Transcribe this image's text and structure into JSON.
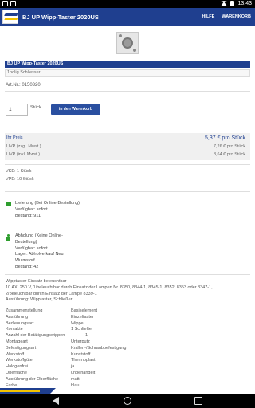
{
  "status_bar": {
    "time": "13:43"
  },
  "app_bar": {
    "title": "BJ UP Wipp-Taster 2020US",
    "menu_help": "HILFE",
    "menu_cart": "WARENKORB"
  },
  "product": {
    "title_bar": "BJ UP Wipp-Taster 2020US",
    "subtitle": "1polig Schliesser",
    "art_nr": "Art.Nr.: 0150320",
    "quantity_value": "1",
    "quantity_unit": "Stück",
    "add_to_cart": "in den Warenkorb"
  },
  "prices": {
    "main_label": "Ihr Preis",
    "main_value": "5,37 € pro  Stück",
    "uvp_excl_label": "UVP (zzgl. Mwst.)",
    "uvp_excl_value": "7,26 € pro  Stück",
    "uvp_incl_label": "UVP (inkl. Mwst.)",
    "uvp_incl_value": "8,64 € pro  Stück"
  },
  "units": {
    "vke": "VKE: 1 Stück",
    "vpe": "VPE: 10 Stück"
  },
  "delivery": {
    "lines": [
      "Lieferung (Bei Online-Bestellung)",
      "Verfügbar: sofort",
      "Bestand: 911"
    ]
  },
  "pickup": {
    "lines": [
      "Abholung (Keine Online-",
      "Bestellung)",
      "Verfügbar: sofort",
      "Lager: Abholverkauf Neu",
      "Wulmstorf",
      "Bestand: 42"
    ]
  },
  "description": {
    "lines": [
      "Wipptaster-Einsatz beleuchtbar",
      "10 AX, 250 V, 1/beleuchtbar durch Einsatz der Lampen Nr. 8350, 8344-1, 8345-1, 8352, 8353 oder 8347-1,",
      "2/beleuchtbar durch Einsatz der Lampe 8339-1",
      "Ausführung: Wipptaster, Schließer"
    ]
  },
  "specs": [
    {
      "key": "Zusammenstellung",
      "value": "Basiselement"
    },
    {
      "key": "Ausführung",
      "value": "Einzeltaster"
    },
    {
      "key": "Bedienungsart",
      "value": "Wippe"
    },
    {
      "key": "Kontakte",
      "value": "1 Schließer"
    },
    {
      "key": "Anzahl der Betätigungswippen",
      "value": "1"
    },
    {
      "key": "Montageart",
      "value": "Unterputz"
    },
    {
      "key": "Befestigungsart",
      "value": "Krallen-/Schraubbefestigung"
    },
    {
      "key": "Werkstoff",
      "value": "Kunststoff"
    },
    {
      "key": "Werkstoffgüte",
      "value": "Thermoplast"
    },
    {
      "key": "Halogenfrei",
      "value": "ja"
    },
    {
      "key": "Oberfläche",
      "value": "unbehandelt"
    },
    {
      "key": "Ausführung der Oberfläche",
      "value": "matt"
    },
    {
      "key": "Farbe",
      "value": "blau"
    }
  ],
  "colors": {
    "brand_blue": "#1f3f8f",
    "brand_yellow": "#f2c200",
    "stock_green": "#2e9e2e"
  }
}
